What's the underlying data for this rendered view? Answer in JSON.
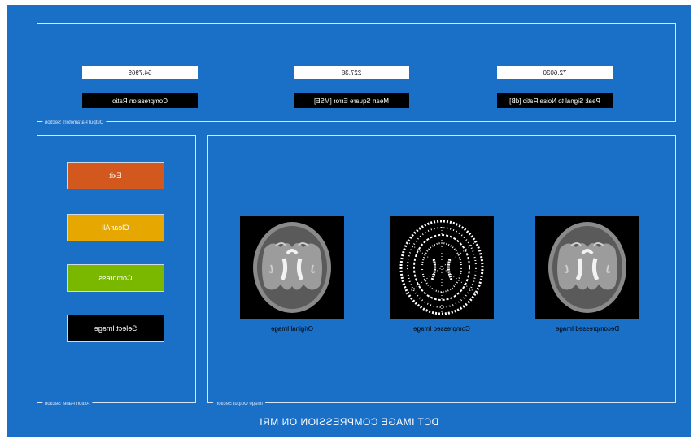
{
  "app": {
    "title": "DCT IMAGE COMPRESSION ON MRI"
  },
  "output_parameters": {
    "section_label": "Output Parameters Section",
    "compression_ratio": {
      "label": "Compression Ratio",
      "value": "64.7969"
    },
    "mse": {
      "label": "Mean Square Error [MSE]",
      "value": "227.38"
    },
    "psnr": {
      "label": "Peak Signal to Noise Ratio [dB]",
      "value": "72.6030"
    }
  },
  "action": {
    "section_label": "Action Panel Section",
    "buttons": {
      "exit": "Exit",
      "clear_all": "Clear All",
      "compress": "Compress",
      "select_image": "Select Image"
    }
  },
  "image_output": {
    "section_label": "Image Output Section",
    "captions": {
      "original": "Original Image",
      "compressed": "Compressed Image",
      "decompressed": "Decompressed Image"
    }
  },
  "colors": {
    "background": "#1a6fc7",
    "exit": "#d2581e",
    "clear_all": "#e6a800",
    "compress": "#7ab800",
    "select_image": "#000000"
  }
}
